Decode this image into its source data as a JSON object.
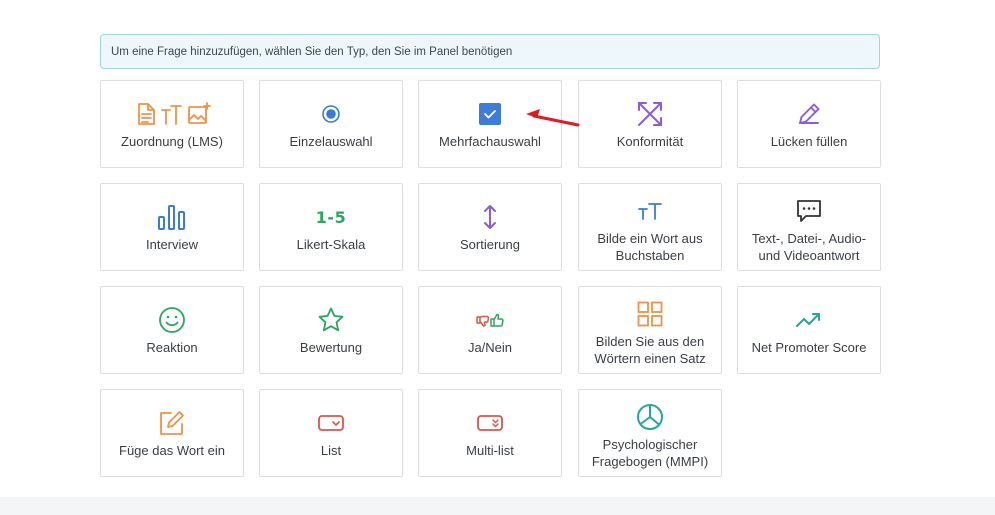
{
  "info": {
    "text": "Um eine Frage hinzuzufügen, wählen Sie den Typ, den Sie im Panel benötigen"
  },
  "tiles": [
    {
      "label": "Zuordnung (LMS)",
      "icon": "lms-icons",
      "color": "#f0924a"
    },
    {
      "label": "Einzelauswahl",
      "icon": "radio-icon",
      "color": "#3a7bd5"
    },
    {
      "label": "Mehrfachauswahl",
      "icon": "checkbox-icon",
      "color": "#3a7bd5"
    },
    {
      "label": "Konformität",
      "icon": "arrows-cross-icon",
      "color": "#8a5be0"
    },
    {
      "label": "Lücken füllen",
      "icon": "pencil-icon",
      "color": "#8a5be0"
    },
    {
      "label": "Interview",
      "icon": "bar-chart-icon",
      "color": "#3a7bd5"
    },
    {
      "label": "Likert-Skala",
      "icon_text": "1-5",
      "icon": "likert-icon",
      "color": "#2ea55d"
    },
    {
      "label": "Sortierung",
      "icon": "vertical-arrows-icon",
      "color": "#8a5be0"
    },
    {
      "label": "Bilde ein Wort aus Buchstaben",
      "icon": "text-size-icon",
      "color": "#3a7bd5"
    },
    {
      "label": "Text-, Datei-, Audio- und Videoantwort",
      "icon": "chat-icon",
      "color": "#333333"
    },
    {
      "label": "Reaktion",
      "icon": "smiley-icon",
      "color": "#2ea55d"
    },
    {
      "label": "Bewertung",
      "icon": "star-icon",
      "color": "#2ea55d"
    },
    {
      "label": "Ja/Nein",
      "icon": "thumbs-icon",
      "color": "#e0524a"
    },
    {
      "label": "Bilden Sie aus den Wörtern einen Satz",
      "icon": "grid-icon",
      "color": "#f0924a"
    },
    {
      "label": "Net Promoter Score",
      "icon": "trend-icon",
      "color": "#26a69a"
    },
    {
      "label": "Füge das Wort ein",
      "icon": "edit-box-icon",
      "color": "#f0924a"
    },
    {
      "label": "List",
      "icon": "dropdown-icon",
      "color": "#e0524a"
    },
    {
      "label": "Multi-list",
      "icon": "multi-dropdown-icon",
      "color": "#e0524a"
    },
    {
      "label": "Psychologischer Fragebogen (MMPI)",
      "icon": "pie-chart-icon",
      "color": "#26a69a"
    }
  ]
}
